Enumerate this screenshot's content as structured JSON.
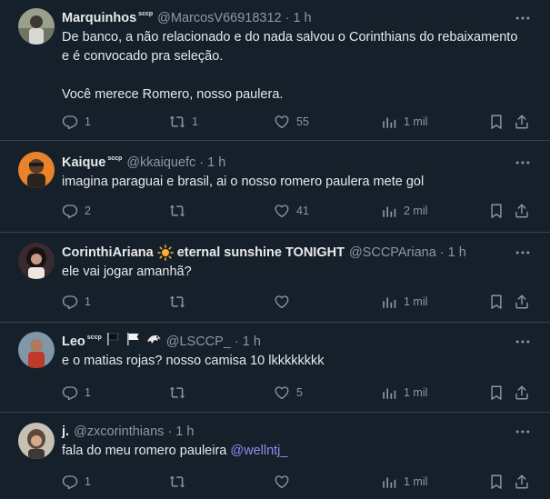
{
  "tweets": [
    {
      "name": "Marquinhos",
      "name_tag": "sccp",
      "handle": "@MarcosV66918312",
      "dot": "·",
      "time": "1 h",
      "text": "De banco, a não relacionado e do nada salvou o Corinthians do rebaixamento\ne é convocado pra seleção.\n\nVocê merece Romero, nosso paulera.",
      "replies": "1",
      "retweets": "1",
      "likes": "55",
      "views": "1 mil"
    },
    {
      "name": "Kaique",
      "name_tag": "sccp",
      "handle": "@kkaiquefc",
      "dot": "·",
      "time": "1 h",
      "text": "imagina paraguai e brasil, ai o nosso romero paulera mete gol",
      "replies": "2",
      "retweets": "",
      "likes": "41",
      "views": "2 mil"
    },
    {
      "name": "CorinthiAriana",
      "name_suffix": "eternal sunshine TONIGHT",
      "handle": "@SCCPAriana",
      "dot": "·",
      "time": "1 h",
      "text": "ele vai jogar amanhã?",
      "replies": "1",
      "retweets": "",
      "likes": "",
      "views": "1 mil"
    },
    {
      "name": "Leo",
      "name_tag": "sccp",
      "handle": "@LSCCP_",
      "dot": "·",
      "time": "1 h",
      "text": "e o matias rojas? nosso camisa 10 lkkkkkkkk",
      "replies": "1",
      "retweets": "",
      "likes": "5",
      "views": "1 mil"
    },
    {
      "name": "j.",
      "handle": "@zxcorinthians",
      "dot": "·",
      "time": "1 h",
      "text": "fala do meu romero pauleira ",
      "mention": "@wellntj_",
      "replies": "1",
      "retweets": "",
      "likes": "",
      "views": "1 mil"
    }
  ],
  "icons": {
    "more": "more-dots-icon",
    "reply": "reply-icon",
    "retweet": "retweet-icon",
    "like": "heart-icon",
    "views": "views-chart-icon",
    "bookmark": "bookmark-icon",
    "share": "share-icon"
  },
  "colors": {
    "background": "#15202b",
    "divider": "#38444d",
    "text": "#e7e9ea",
    "muted": "#8b98a5",
    "mention": "#8e8ef0"
  }
}
